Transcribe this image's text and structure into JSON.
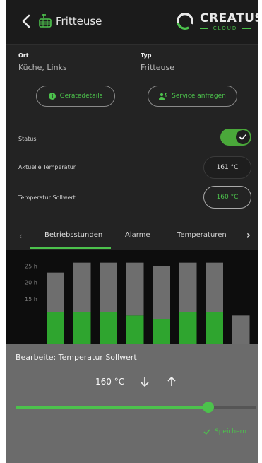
{
  "header": {
    "title": "Fritteuse",
    "logo_text": "CREATUS",
    "logo_sub": "CLOUD"
  },
  "info": {
    "ort_label": "Ort",
    "ort_value": "Küche, Links",
    "typ_label": "Typ",
    "typ_value": "Fritteuse"
  },
  "buttons": {
    "details": "Gerätedetails",
    "service": "Service anfragen"
  },
  "rows": {
    "status_label": "Status",
    "status_on": true,
    "current_label": "Aktuelle Temperatur",
    "current_value": "161 °C",
    "setpoint_label": "Temperatur Sollwert",
    "setpoint_value": "160 °C"
  },
  "tabs": [
    {
      "label": "Betriebsstunden",
      "active": true
    },
    {
      "label": "Alarme",
      "active": false
    },
    {
      "label": "Temperaturen",
      "active": false
    }
  ],
  "chart_data": {
    "type": "bar",
    "y_ticks": [
      "25 h",
      "20 h",
      "15 h"
    ],
    "categories": [
      "",
      "",
      "",
      "",
      "",
      "",
      "",
      ""
    ],
    "series": [
      {
        "values": [
          11,
          11,
          11,
          10,
          9,
          11,
          11,
          0
        ]
      },
      {
        "values": [
          12,
          15,
          15,
          16,
          16,
          15,
          15,
          10
        ]
      }
    ],
    "colors": [
      "#2fa52f",
      "#6e6e6e"
    ],
    "ylim": [
      0,
      30
    ]
  },
  "sheet": {
    "title": "Bearbeite: Temperatur Sollwert",
    "value": "160 °C",
    "slider_fraction": 0.8,
    "save_label": "Speichern"
  },
  "colors": {
    "accent": "#4cc24c",
    "background": "#232323"
  }
}
